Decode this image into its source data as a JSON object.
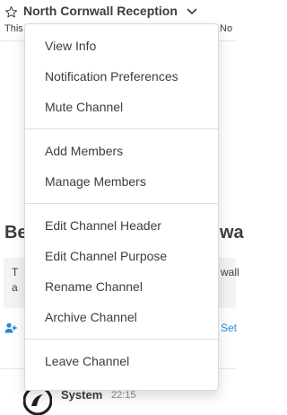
{
  "channel_header": {
    "name": "North Cornwall Reception",
    "desc_left": "This",
    "desc_right": "No"
  },
  "intro": {
    "title_left": "Be",
    "title_right": "wa",
    "box_line1": "T",
    "box_line2": "a",
    "box_right": "wall",
    "set_link": "Set"
  },
  "post": {
    "author": "System",
    "time": "22:15"
  },
  "menu": {
    "sections": [
      [
        {
          "label": "View Info",
          "name": "menu-item-view-info"
        },
        {
          "label": "Notification Preferences",
          "name": "menu-item-notification-preferences"
        },
        {
          "label": "Mute Channel",
          "name": "menu-item-mute-channel"
        }
      ],
      [
        {
          "label": "Add Members",
          "name": "menu-item-add-members"
        },
        {
          "label": "Manage Members",
          "name": "menu-item-manage-members"
        }
      ],
      [
        {
          "label": "Edit Channel Header",
          "name": "menu-item-edit-channel-header"
        },
        {
          "label": "Edit Channel Purpose",
          "name": "menu-item-edit-channel-purpose"
        },
        {
          "label": "Rename Channel",
          "name": "menu-item-rename-channel"
        },
        {
          "label": "Archive Channel",
          "name": "menu-item-archive-channel"
        }
      ],
      [
        {
          "label": "Leave Channel",
          "name": "menu-item-leave-channel"
        }
      ]
    ]
  },
  "colors": {
    "text": "#3d3c40",
    "link": "#2389d7",
    "separator": "#dddddd",
    "muted": "#8c8c8f"
  },
  "icons": [
    "star-icon",
    "chevron-down-icon",
    "add-member-icon",
    "system-avatar-icon"
  ]
}
